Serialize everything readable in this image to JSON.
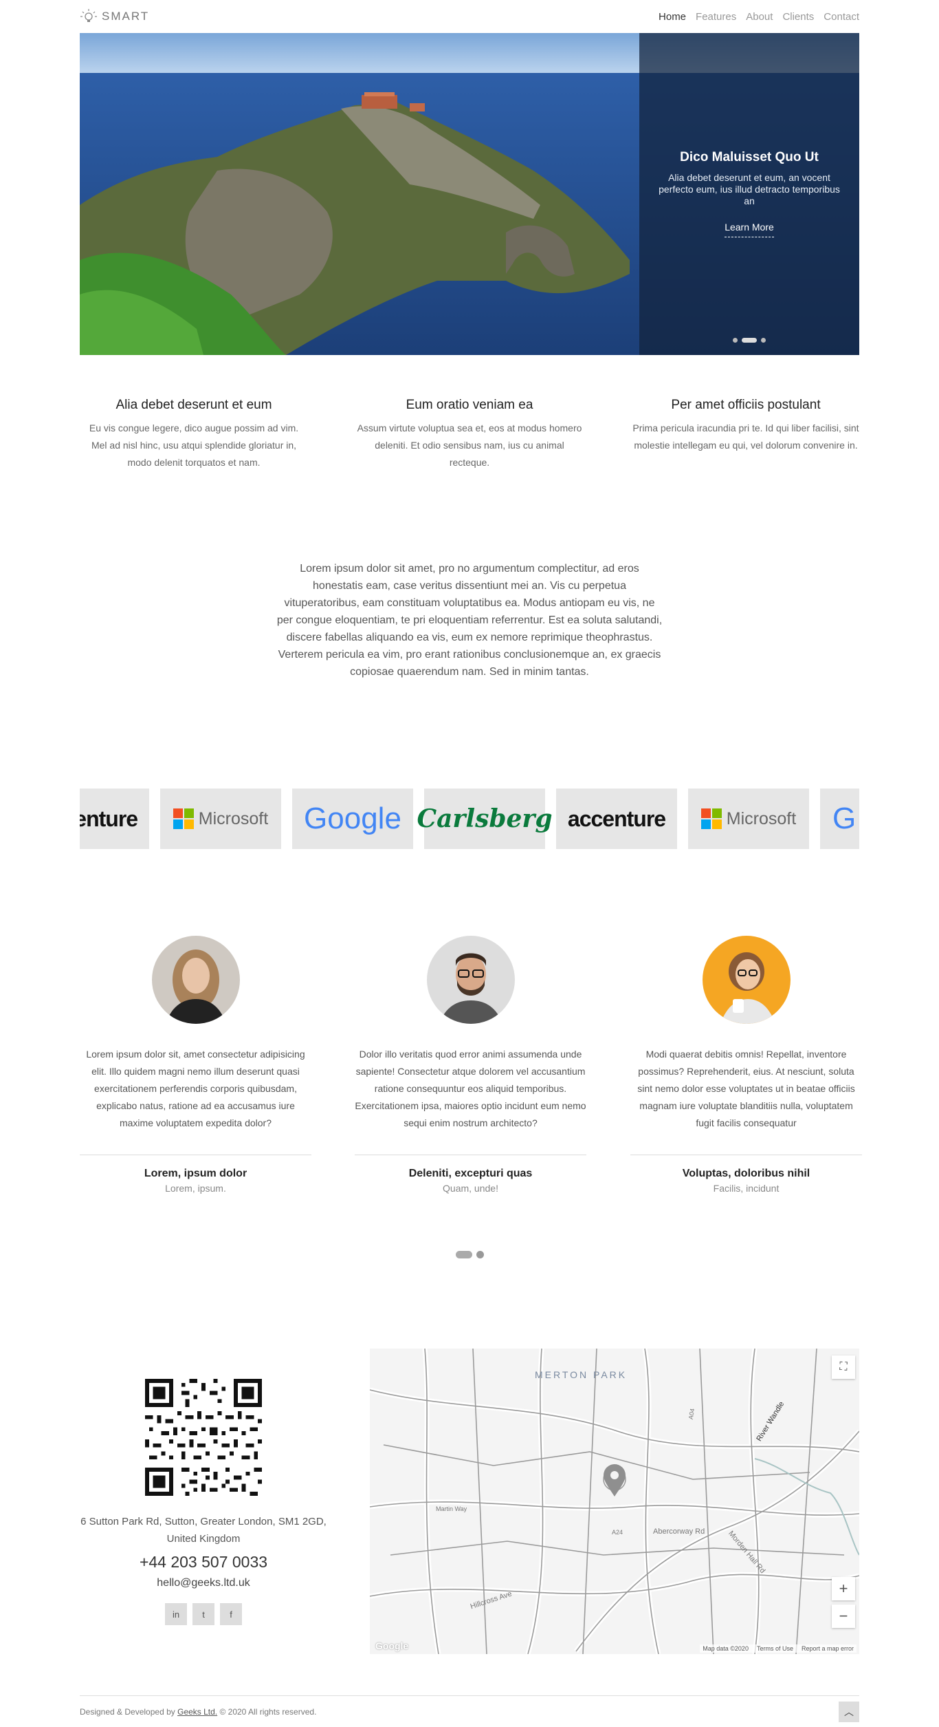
{
  "header": {
    "logo_text": "SMART",
    "nav": [
      "Home",
      "Features",
      "About",
      "Clients",
      "Contact"
    ]
  },
  "hero": {
    "title": "Dico Maluisset Quo Ut",
    "text": "Alia debet deserunt et eum, an vocent perfecto eum, ius illud detracto temporibus an",
    "button": "Learn More"
  },
  "features": [
    {
      "title": "Alia debet deserunt et eum",
      "text": "Eu vis congue legere, dico augue possim ad vim. Mel ad nisl hinc, usu atqui splendide gloriatur in, modo delenit torquatos et nam."
    },
    {
      "title": "Eum oratio veniam ea",
      "text": "Assum virtute voluptua sea et, eos at modus homero deleniti. Et odio sensibus nam, ius cu animal recteque."
    },
    {
      "title": "Per amet officiis postulant",
      "text": "Prima pericula iracundia pri te. Id qui liber facilisi, sint molestie intellegam eu qui, vel dolorum convenire in."
    }
  ],
  "intro": "Lorem ipsum dolor sit amet, pro no argumentum complectitur, ad eros honestatis eam, case veritus dissentiunt mei an. Vis cu perpetua vituperatoribus, eam constituam voluptatibus ea. Modus antiopam eu vis, ne per congue eloquentiam, te pri eloquentiam referrentur. Est ea soluta salutandi, discere fabellas aliquando ea vis, eum ex nemore reprimique theophrastus. Verterem pericula ea vim, pro erant rationibus conclusionemque an, ex graecis copiosae quaerendum nam. Sed in minim tantas.",
  "clients": {
    "accenture": "accenture",
    "microsoft": "Microsoft",
    "google": "Google",
    "carlsberg": "Carlsberg",
    "google_partial": "G"
  },
  "testimonials": [
    {
      "text": "Lorem ipsum dolor sit, amet consectetur adipisicing elit. Illo quidem magni nemo illum deserunt quasi exercitationem perferendis corporis quibusdam, explicabo natus, ratione ad ea accusamus iure maxime voluptatem expedita dolor?",
      "name": "Lorem, ipsum dolor",
      "role": "Lorem, ipsum."
    },
    {
      "text": "Dolor illo veritatis quod error animi assumenda unde sapiente! Consectetur atque dolorem vel accusantium ratione consequuntur eos aliquid temporibus. Exercitationem ipsa, maiores optio incidunt eum nemo sequi enim nostrum architecto?",
      "name": "Deleniti, excepturi quas",
      "role": "Quam, unde!"
    },
    {
      "text": "Modi quaerat debitis omnis! Repellat, inventore possimus? Reprehenderit, eius. At nesciunt, soluta sint nemo dolor esse voluptates ut in beatae officiis magnam iure voluptate blanditiis nulla, voluptatem fugit facilis consequatur",
      "name": "Voluptas, doloribus nihil",
      "role": "Facilis, incidunt"
    }
  ],
  "contact": {
    "address": "6 Sutton Park Rd, Sutton, Greater London, SM1 2GD, United Kingdom",
    "phone": "+44 203 507 0033",
    "email": "hello@geeks.ltd.uk",
    "socials": [
      "in",
      "t",
      "f"
    ]
  },
  "map": {
    "labels": {
      "park": "MERTON PARK",
      "river": "River Wandle",
      "road1": "Martin Way",
      "road2": "Abercorway Rd",
      "road3": "Morden Hall Rd",
      "road4": "Hillcross Ave",
      "a24": "A24",
      "a04": "A04"
    },
    "footer": [
      "Map data ©2020",
      "Terms of Use",
      "Report a map error"
    ],
    "google": "Google"
  },
  "footer": {
    "prefix": "Designed & Developed by",
    "company": "Geeks Ltd.",
    "suffix": "© 2020 All rights reserved."
  },
  "colors": {
    "accent": "#333333",
    "hero_overlay": "#12233c",
    "carlsberg_green": "#0a7a3c"
  }
}
